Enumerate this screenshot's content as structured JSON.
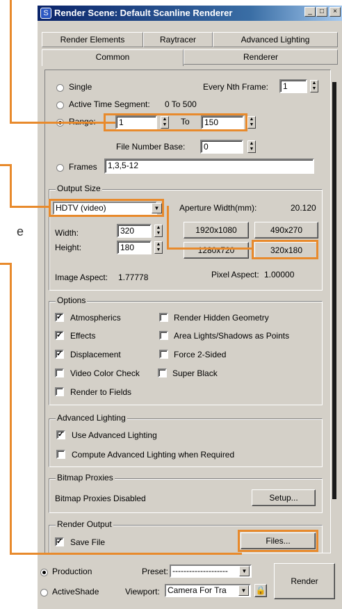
{
  "window": {
    "title": "Render Scene: Default Scanline Renderer",
    "icon": "3dsmax-logo-icon"
  },
  "tabs_row1": [
    "Render Elements",
    "Raytracer",
    "Advanced Lighting"
  ],
  "tabs_row2": [
    "Common",
    "Renderer"
  ],
  "active_tab": "Common",
  "time_output": {
    "single_label": "Single",
    "every_nth_label": "Every Nth Frame:",
    "every_nth_value": "1",
    "active_segment_label": "Active Time Segment:",
    "active_segment_value": "0 To 500",
    "range_label": "Range:",
    "range_from": "1",
    "range_to_label": "To",
    "range_to": "150",
    "file_number_base_label": "File Number Base:",
    "file_number_base_value": "0",
    "frames_label": "Frames",
    "frames_value": "1,3,5-12",
    "selected": "Range"
  },
  "output_size": {
    "legend": "Output Size",
    "format": "HDTV (video)",
    "aperture_label": "Aperture Width(mm):",
    "aperture_value": "20.120",
    "width_label": "Width:",
    "width_value": "320",
    "height_label": "Height:",
    "height_value": "180",
    "presets": [
      "1920x1080",
      "490x270",
      "1280x720",
      "320x180"
    ],
    "image_aspect_label": "Image Aspect:",
    "image_aspect_value": "1.77778",
    "pixel_aspect_label": "Pixel Aspect:",
    "pixel_aspect_value": "1.00000"
  },
  "options": {
    "legend": "Options",
    "items": [
      {
        "label": "Atmospherics",
        "checked": true
      },
      {
        "label": "Render Hidden Geometry",
        "checked": false
      },
      {
        "label": "Effects",
        "checked": true
      },
      {
        "label": "Area Lights/Shadows as Points",
        "checked": false
      },
      {
        "label": "Displacement",
        "checked": true
      },
      {
        "label": "Force 2-Sided",
        "checked": false
      },
      {
        "label": "Video Color Check",
        "checked": false
      },
      {
        "label": "Super Black",
        "checked": false
      },
      {
        "label": "Render to Fields",
        "checked": false
      }
    ]
  },
  "advanced_lighting": {
    "legend": "Advanced Lighting",
    "use_label": "Use Advanced Lighting",
    "use_checked": true,
    "compute_label": "Compute Advanced Lighting when Required",
    "compute_checked": false
  },
  "bitmap_proxies": {
    "legend": "Bitmap Proxies",
    "status": "Bitmap Proxies Disabled",
    "setup_label": "Setup..."
  },
  "render_output": {
    "legend": "Render Output",
    "save_file_label": "Save File",
    "save_file_checked": true,
    "files_label": "Files..."
  },
  "bottom": {
    "production_label": "Production",
    "activeshade_label": "ActiveShade",
    "preset_label": "Preset:",
    "preset_value": "--------------------",
    "viewport_label": "Viewport:",
    "viewport_value": "Camera For Tra",
    "render_label": "Render",
    "mode_selected": "Production"
  },
  "overlay_text": {
    "left_fragment": "e"
  },
  "colors": {
    "highlight": "#e88a2c",
    "titlebar": "#0a246a",
    "face": "#d4d0c8"
  }
}
